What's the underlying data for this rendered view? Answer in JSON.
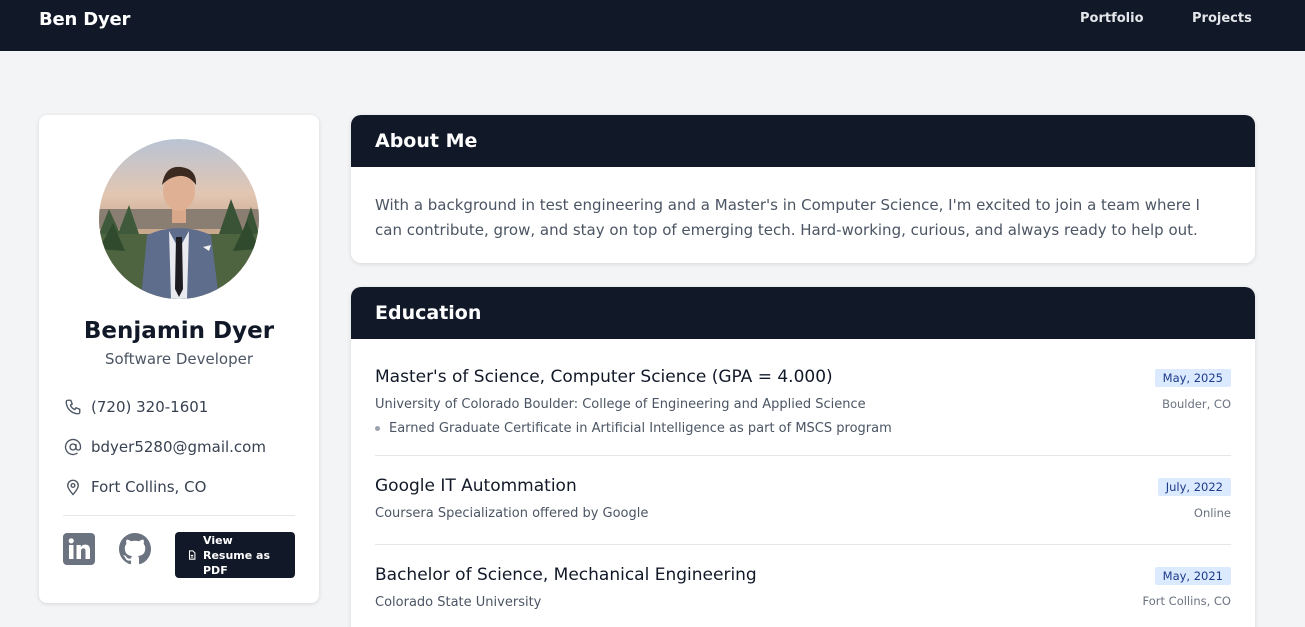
{
  "nav": {
    "brand": "Ben Dyer",
    "links": [
      "Portfolio",
      "Projects"
    ]
  },
  "profile": {
    "name": "Benjamin Dyer",
    "title": "Software Developer",
    "phone": "(720) 320-1601",
    "email": "bdyer5280@gmail.com",
    "location": "Fort Collins, CO",
    "resume_button": "View Resume as PDF",
    "icons": [
      "phone-icon",
      "at-icon",
      "map-pin-icon",
      "linkedin-icon",
      "github-icon",
      "file-icon"
    ]
  },
  "about": {
    "heading": "About Me",
    "text": "With a background in test engineering and a Master's in Computer Science, I'm excited to join a team where I can contribute, grow, and stay on top of emerging tech. Hard-working, curious, and always ready to help out."
  },
  "education": {
    "heading": "Education",
    "items": [
      {
        "degree": "Master's of Science, Computer Science (GPA = 4.000)",
        "school": "University of Colorado Boulder: College of Engineering and Applied Science",
        "note": "Earned Graduate Certificate in Artificial Intelligence as part of MSCS program",
        "date": "May, 2025",
        "place": "Boulder, CO"
      },
      {
        "degree": "Google IT Autommation",
        "school": "Coursera Specialization offered by Google",
        "date": "July, 2022",
        "place": "Online"
      },
      {
        "degree": "Bachelor of Science, Mechanical Engineering",
        "school": "Colorado State University",
        "date": "May, 2021",
        "place": "Fort Collins, CO"
      }
    ]
  },
  "colors": {
    "nav_bg": "#111827",
    "page_bg": "#f3f4f6",
    "date_badge_bg": "#dbeafe",
    "date_badge_text": "#1e3a8a"
  }
}
